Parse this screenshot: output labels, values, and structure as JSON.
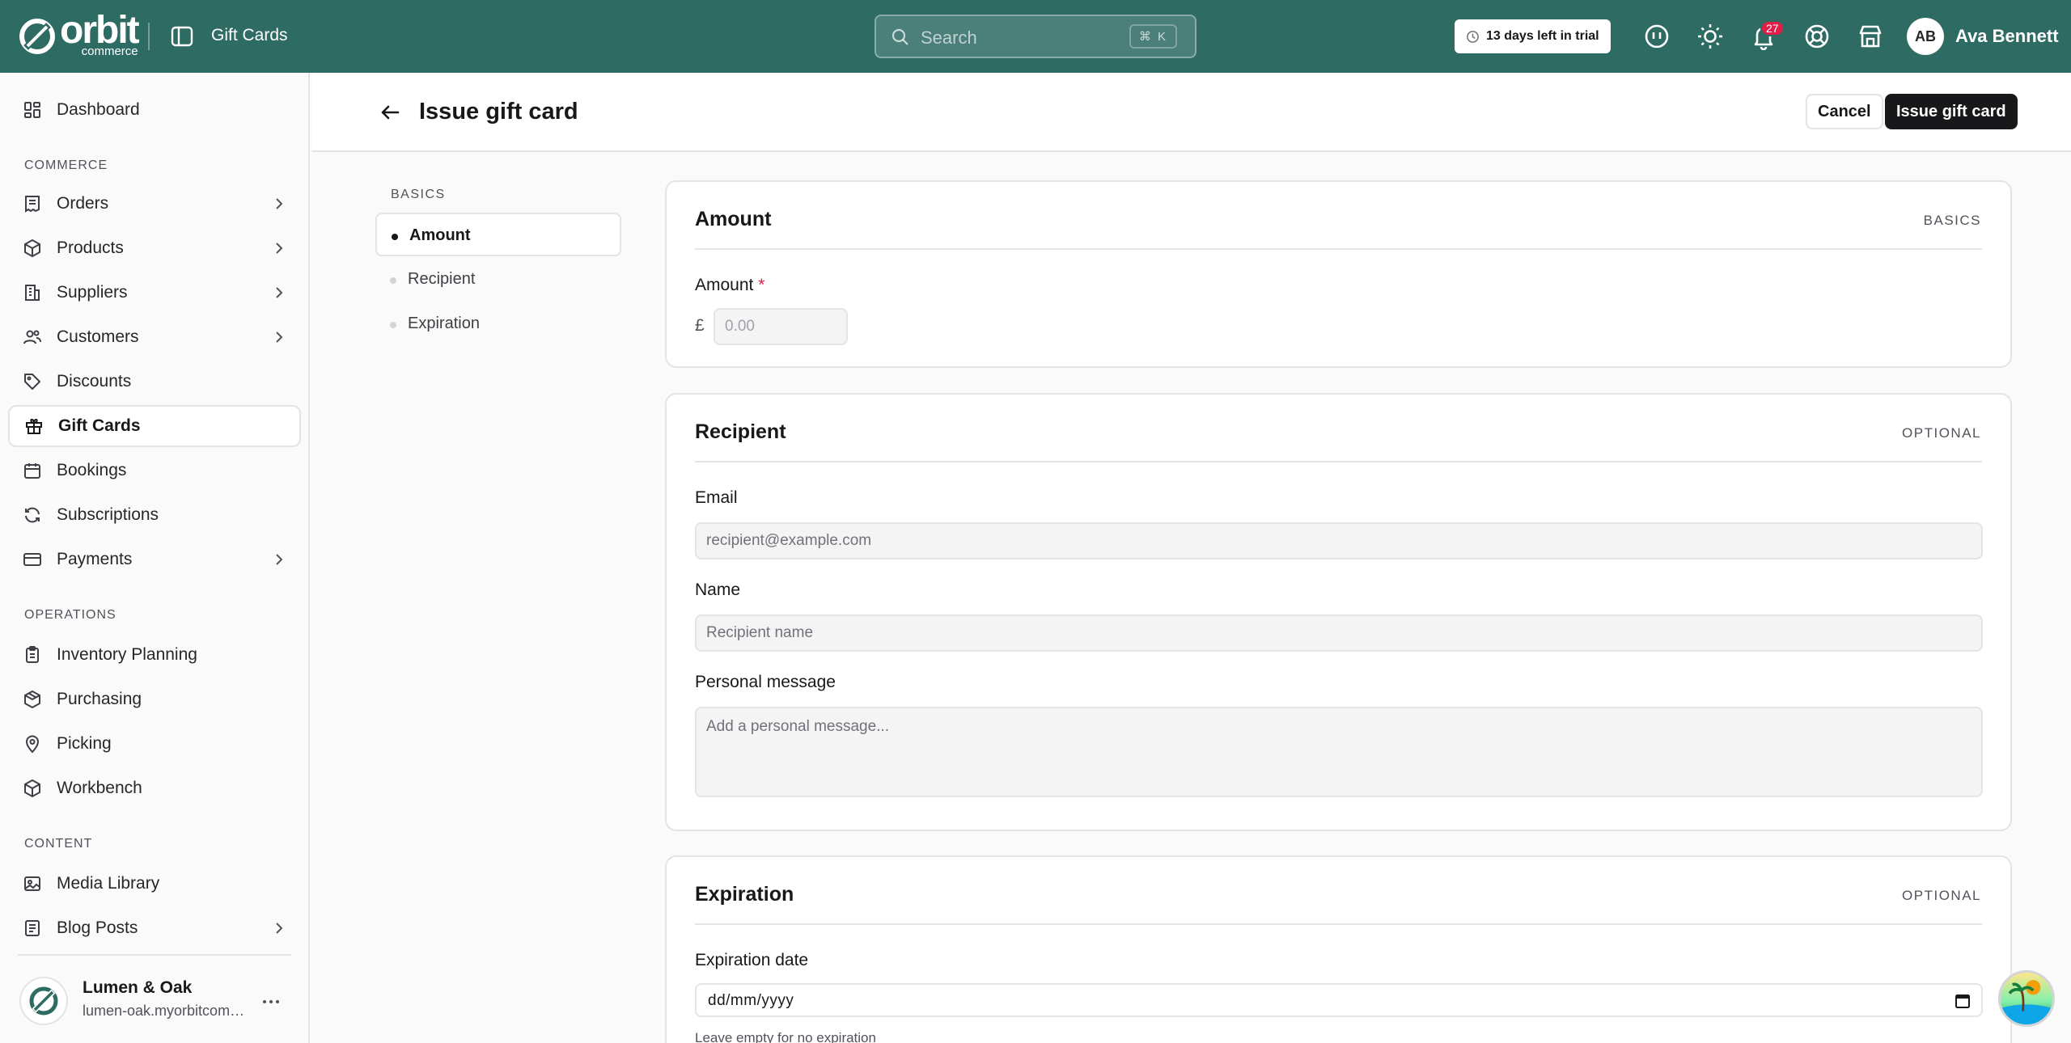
{
  "brand": {
    "logo_word": "orbit",
    "logo_sub": "commerce"
  },
  "topbar": {
    "breadcrumb": "Gift Cards",
    "search_placeholder": "Search",
    "search_shortcut": "⌘ K",
    "trial_text": "13 days left in trial",
    "notification_count": "27",
    "user_initials": "AB",
    "user_name": "Ava Bennett",
    "icons": [
      "sidebar-toggle-icon",
      "search-icon",
      "clock-icon",
      "ai-assistant-icon",
      "theme-sun-icon",
      "bell-icon",
      "help-lifebuoy-icon",
      "storefront-icon"
    ]
  },
  "sidebar": {
    "top": [
      {
        "label": "Dashboard",
        "icon": "dashboard-icon"
      }
    ],
    "sections": [
      {
        "title": "COMMERCE",
        "items": [
          {
            "label": "Orders",
            "icon": "orders-icon",
            "chevron": true
          },
          {
            "label": "Products",
            "icon": "box-icon",
            "chevron": true
          },
          {
            "label": "Suppliers",
            "icon": "building-icon",
            "chevron": true
          },
          {
            "label": "Customers",
            "icon": "users-icon",
            "chevron": true
          },
          {
            "label": "Discounts",
            "icon": "tag-icon",
            "chevron": false
          },
          {
            "label": "Gift Cards",
            "icon": "gift-icon",
            "chevron": false,
            "active": true
          },
          {
            "label": "Bookings",
            "icon": "calendar-icon",
            "chevron": false
          },
          {
            "label": "Subscriptions",
            "icon": "refresh-icon",
            "chevron": false
          },
          {
            "label": "Payments",
            "icon": "credit-card-icon",
            "chevron": true
          }
        ]
      },
      {
        "title": "OPERATIONS",
        "items": [
          {
            "label": "Inventory Planning",
            "icon": "clipboard-icon",
            "chevron": false
          },
          {
            "label": "Purchasing",
            "icon": "package-icon",
            "chevron": false
          },
          {
            "label": "Picking",
            "icon": "map-pin-icon",
            "chevron": false
          },
          {
            "label": "Workbench",
            "icon": "cube-icon",
            "chevron": false
          }
        ]
      },
      {
        "title": "CONTENT",
        "items": [
          {
            "label": "Media Library",
            "icon": "image-icon",
            "chevron": false
          },
          {
            "label": "Blog Posts",
            "icon": "document-icon",
            "chevron": true
          }
        ]
      }
    ],
    "store": {
      "name": "Lumen & Oak",
      "url": "lumen-oak.myorbitcommerce.com"
    }
  },
  "header": {
    "title": "Issue gift card",
    "cancel_label": "Cancel",
    "primary_label": "Issue gift card"
  },
  "section_nav": {
    "title": "BASICS",
    "items": [
      {
        "label": "Amount",
        "active": true
      },
      {
        "label": "Recipient",
        "active": false
      },
      {
        "label": "Expiration",
        "active": false
      }
    ]
  },
  "cards": {
    "amount": {
      "title": "Amount",
      "tag": "BASICS",
      "label": "Amount",
      "required_mark": "*",
      "currency": "£",
      "placeholder": "0.00"
    },
    "recipient": {
      "title": "Recipient",
      "tag": "OPTIONAL",
      "email_label": "Email",
      "email_placeholder": "recipient@example.com",
      "name_label": "Name",
      "name_placeholder": "Recipient name",
      "message_label": "Personal message",
      "message_placeholder": "Add a personal message..."
    },
    "expiration": {
      "title": "Expiration",
      "tag": "OPTIONAL",
      "date_label": "Expiration date",
      "date_placeholder": "dd/mm/yyyy",
      "hint": "Leave empty for no expiration"
    }
  },
  "colors": {
    "topbar": "#2e6b63",
    "primary_button": "#18181b",
    "required": "#e11d48",
    "badge": "#e11d48"
  }
}
